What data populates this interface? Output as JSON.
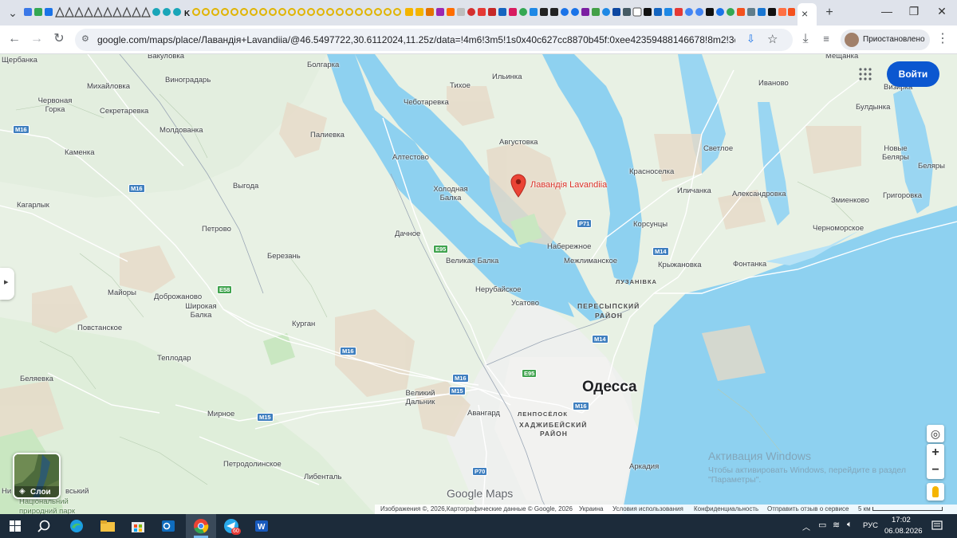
{
  "browser": {
    "tab_title_close": "×",
    "new_tab": "+",
    "window_controls": {
      "minimize": "—",
      "maximize": "❐",
      "close": "✕"
    },
    "url": "google.com/maps/place/Лавандія+Lavandiia/@46.5497722,30.6112024,11.25z/data=!4m6!3m5!1s0x40c627cc8870b45f:0xee42359488146678!8m2!3d46.6065299!4d...",
    "profile_label": "Приостановлено"
  },
  "maps": {
    "signin_label": "Войти",
    "layers_label": "Слои",
    "logo": "Google Maps",
    "place_pin": "Лавандія Lavandiia",
    "city": "Одесса",
    "zoom_in": "+",
    "zoom_out": "−",
    "footer": {
      "imagery": "Изображения ©, 2026,Картографические данные © Google, 2026",
      "country": "Украина",
      "terms": "Условия использования",
      "privacy": "Конфиденциальность",
      "feedback": "Отправить отзыв о сервисе",
      "scale": "5 км"
    },
    "watermark": {
      "title": "Активация Windows",
      "line1": "Чтобы активировать Windows, перейдите в раздел",
      "line2": "\"Параметры\"."
    },
    "labels": {
      "l01": "Щербанка",
      "l02": "Вакуловка",
      "l03": "Болгарка",
      "l04": "Ильинка",
      "l05": "Мещанка",
      "l06": "Михайловка",
      "l07": "Виноградарь",
      "l08": "Тихое",
      "l09": "Иваново",
      "l10": "Визирка",
      "l11": "Червоная Горка",
      "l12": "Секретаревка",
      "l13": "Чеботаревка",
      "l14": "Булдынка",
      "l15": "Молдованка",
      "l16": "Палиевка",
      "l17": "Августовка",
      "l18": "Светлое",
      "l19": "Новые Беляры",
      "l20": "Каменка",
      "l21": "Алтестово",
      "l22": "Красноселка",
      "l23": "Беляры",
      "l24": "Холодная Балка",
      "l25": "Выгода",
      "l26": "Иличанка",
      "l27": "Александровка",
      "l28": "Григоровка",
      "l29": "Кагарлык",
      "l30": "Змиенково",
      "l31": "Корсунцы",
      "l32": "Черноморское",
      "l33": "Петрово",
      "l34": "Дачное",
      "l35": "Березань",
      "l36": "Великая Балка",
      "l37": "Набережное",
      "l38": "Межлиманское",
      "l39": "Крыжановка",
      "l40": "Фонтанка",
      "l41": "Майоры",
      "l42": "Доброжаново",
      "l43": "Нерубайское",
      "l44": "Широкая Балка",
      "l45": "Усатово",
      "l46": "Повстанское",
      "l47": "Курган",
      "l48": "Теплодар",
      "l49": "Беляевка",
      "l50": "Великий Дальник",
      "l51": "Мирное",
      "l52": "Авангард",
      "l53": "Петродолинское",
      "l54": "Либенталь",
      "l55": "Аркадия",
      "l56": "Ни",
      "l57": "вський",
      "l58": "Національний",
      "l59": "природний парк"
    },
    "districts": {
      "d1": "ЛУЗАНІВКА",
      "d2": "ПЕРЕСЫПСКИЙ",
      "d3": "РАЙОН",
      "d4": "ЛЕНПОСЁЛОК",
      "d5": "ХАДЖИБЕЙСКИЙ",
      "d6": "РАЙОН"
    },
    "roads": {
      "r1": "M16",
      "r2": "M16",
      "r3": "E95",
      "r4": "P71",
      "r5": "M14",
      "r6": "E58",
      "r7": "M16",
      "r8": "M16",
      "r9": "M15",
      "r10": "E95",
      "r11": "M14",
      "r12": "M16",
      "r13": "M15",
      "r14": "P70"
    }
  },
  "taskbar": {
    "lang": "РУС",
    "time": "17:02",
    "date": "06.08.2026",
    "badge": "60"
  },
  "colors": {
    "land": "#e8f1e4",
    "water": "#8ed1f0",
    "accent": "#0b57d0",
    "pin": "#ea4335",
    "taskbar": "#1c2b3a"
  }
}
